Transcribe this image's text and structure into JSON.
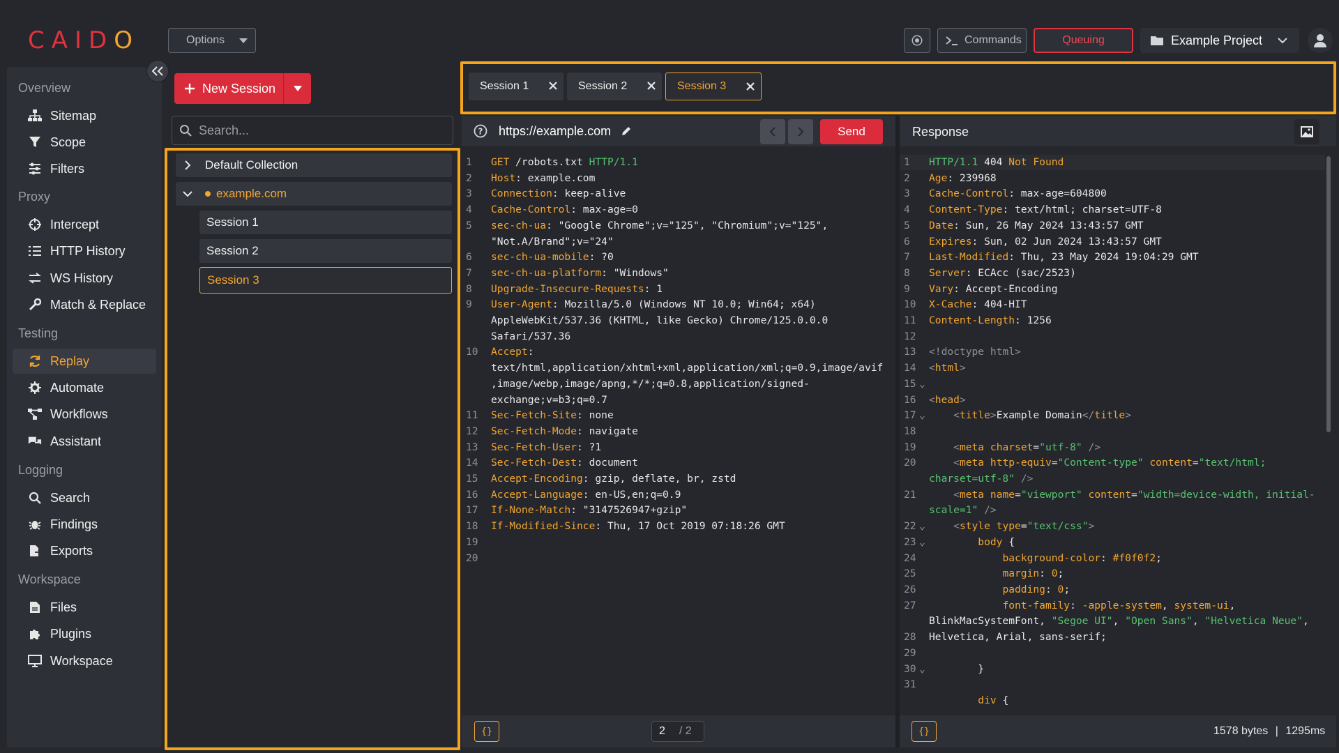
{
  "app": {
    "logo": "CAIDO"
  },
  "topbar": {
    "options_label": "Options",
    "commands_label": "Commands",
    "queuing_label": "Queuing",
    "project_label": "Example Project"
  },
  "nav": {
    "sections": [
      {
        "title": "Overview",
        "items": [
          "Sitemap",
          "Scope",
          "Filters"
        ]
      },
      {
        "title": "Proxy",
        "items": [
          "Intercept",
          "HTTP History",
          "WS History",
          "Match & Replace"
        ]
      },
      {
        "title": "Testing",
        "items": [
          "Replay",
          "Automate",
          "Workflows",
          "Assistant"
        ]
      },
      {
        "title": "Logging",
        "items": [
          "Search",
          "Findings",
          "Exports"
        ]
      },
      {
        "title": "Workspace",
        "items": [
          "Files",
          "Plugins",
          "Workspace"
        ]
      }
    ],
    "active": "Replay"
  },
  "collections": {
    "new_session_label": "New Session",
    "search_placeholder": "Search...",
    "default_collection": "Default Collection",
    "example_collection": "example.com",
    "sessions": [
      "Session 1",
      "Session 2",
      "Session 3"
    ],
    "active_session": "Session 3"
  },
  "tabs": [
    "Session 1",
    "Session 2",
    "Session 3"
  ],
  "request": {
    "url": "https://example.com",
    "send_label": "Send",
    "page_current": "2",
    "page_total": "/ 2"
  },
  "response": {
    "title": "Response",
    "bytes": "1578 bytes",
    "separator": "|",
    "time": "1295ms"
  },
  "format_label": "{}",
  "colors": {
    "accent": "#f2a531",
    "brand_red": "#da2c3a",
    "highlight": "#f5a51c"
  }
}
